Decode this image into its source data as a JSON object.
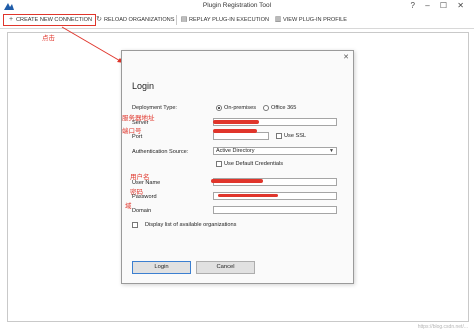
{
  "window": {
    "title": "Plugin Registration Tool",
    "controls": "? – ☐ ✕"
  },
  "toolbar": {
    "create_connection": "CREATE NEW CONNECTION",
    "reload_organizations": "RELOAD ORGANIZATIONS",
    "replay_plugin": "REPLAY PLUG-IN EXECUTION",
    "view_profile": "VIEW PLUG-IN PROFILE"
  },
  "annotations": {
    "click_note": "点击",
    "server_note": "服务器地址",
    "port_note": "端口号",
    "username_note": "用户名",
    "password_note": "密码",
    "domain_note": "域"
  },
  "login": {
    "title": "Login",
    "deployment_type_label": "Deployment Type:",
    "on_premises_label": "On-premises",
    "office365_label": "Office 365",
    "server_label": "Server",
    "port_label": "Port",
    "use_ssl_label": "Use SSL",
    "auth_source_label": "Authentication Source:",
    "auth_source_value": "Active Directory",
    "use_default_credentials_label": "Use Default Credentials",
    "user_name_label": "User Name",
    "password_label": "Password",
    "domain_label": "Domain",
    "display_orgs_label": "Display list of available organizations",
    "login_button": "Login",
    "cancel_button": "Cancel"
  },
  "watermark": "https://blog.csdn.net/..."
}
